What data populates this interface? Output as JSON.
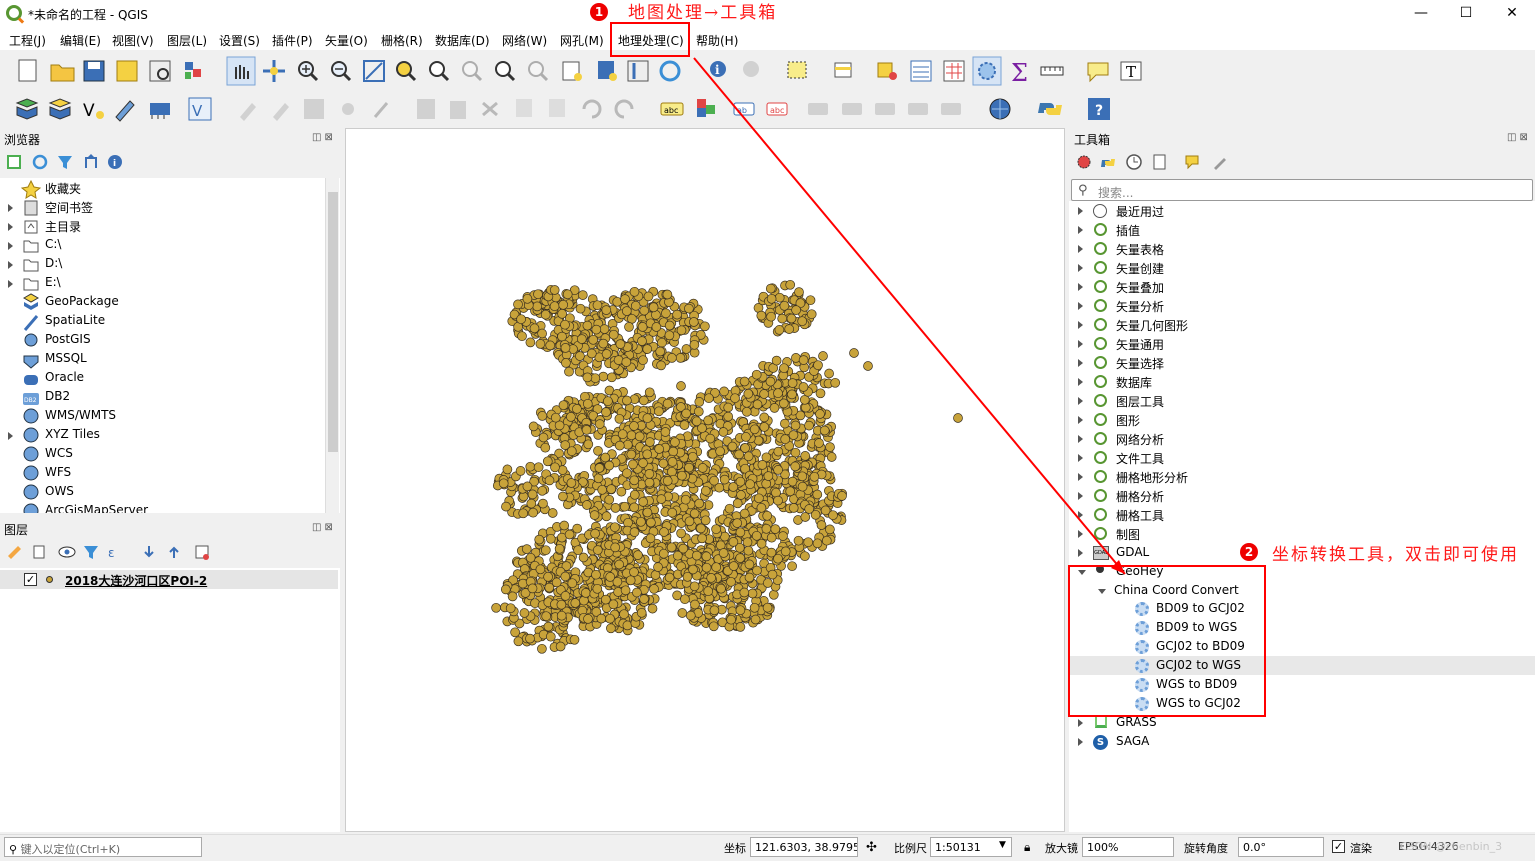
{
  "window": {
    "title": "*未命名的工程 - QGIS",
    "minimize": "—",
    "maximize": "☐",
    "close": "✕"
  },
  "menubar": [
    "工程(J)",
    "编辑(E)",
    "视图(V)",
    "图层(L)",
    "设置(S)",
    "插件(P)",
    "矢量(O)",
    "栅格(R)",
    "数据库(D)",
    "网络(W)",
    "网孔(M)",
    "地理处理(C)",
    "帮助(H)"
  ],
  "browser": {
    "title": "浏览器",
    "items": [
      "收藏夹",
      "空间书签",
      "主目录",
      "C:\\",
      "D:\\",
      "E:\\",
      "GeoPackage",
      "SpatiaLite",
      "PostGIS",
      "MSSQL",
      "Oracle",
      "DB2",
      "WMS/WMTS",
      "XYZ Tiles",
      "WCS",
      "WFS",
      "OWS",
      "ArcGisMapServer"
    ]
  },
  "layers": {
    "title": "图层",
    "items": [
      "2018大连沙河口区POI-2"
    ]
  },
  "toolbox": {
    "title": "工具箱",
    "search_placeholder": "搜索...",
    "groups": [
      "最近用过",
      "插值",
      "矢量表格",
      "矢量创建",
      "矢量叠加",
      "矢量分析",
      "矢量几何图形",
      "矢量通用",
      "矢量选择",
      "数据库",
      "图层工具",
      "图形",
      "网络分析",
      "文件工具",
      "栅格地形分析",
      "栅格分析",
      "栅格工具",
      "制图",
      "GDAL",
      "GeoHey"
    ],
    "geohey_sub": "China Coord Convert",
    "geohey_tools": [
      "BD09 to GCJ02",
      "BD09 to WGS",
      "GCJ02 to BD09",
      "GCJ02 to WGS",
      "WGS to BD09",
      "WGS to GCJ02"
    ],
    "after_groups": [
      "GRASS",
      "SAGA"
    ]
  },
  "statusbar": {
    "locator_placeholder": "键入以定位(Ctrl+K)",
    "coord_label": "坐标",
    "coord_value": "121.6303, 38.9795",
    "scale_label": "比例尺",
    "scale_value": "1:50131",
    "magnifier_label": "放大镜",
    "magnifier_value": "100%",
    "rotation_label": "旋转角度",
    "rotation_value": "0.0°",
    "render_label": "渲染",
    "crs": "EPSG:4326",
    "watermark": "CSDN @chenbin_3"
  },
  "annotations": {
    "step1_badge": "1",
    "step1_text": "地图处理→工具箱",
    "step2_badge": "2",
    "step2_text": "坐标转换工具，双击即可使用"
  },
  "colors": {
    "point_fill": "#c8a33a",
    "point_stroke": "#3a3020",
    "annotation_red": "#ff0000",
    "qgis_green": "#589632"
  }
}
